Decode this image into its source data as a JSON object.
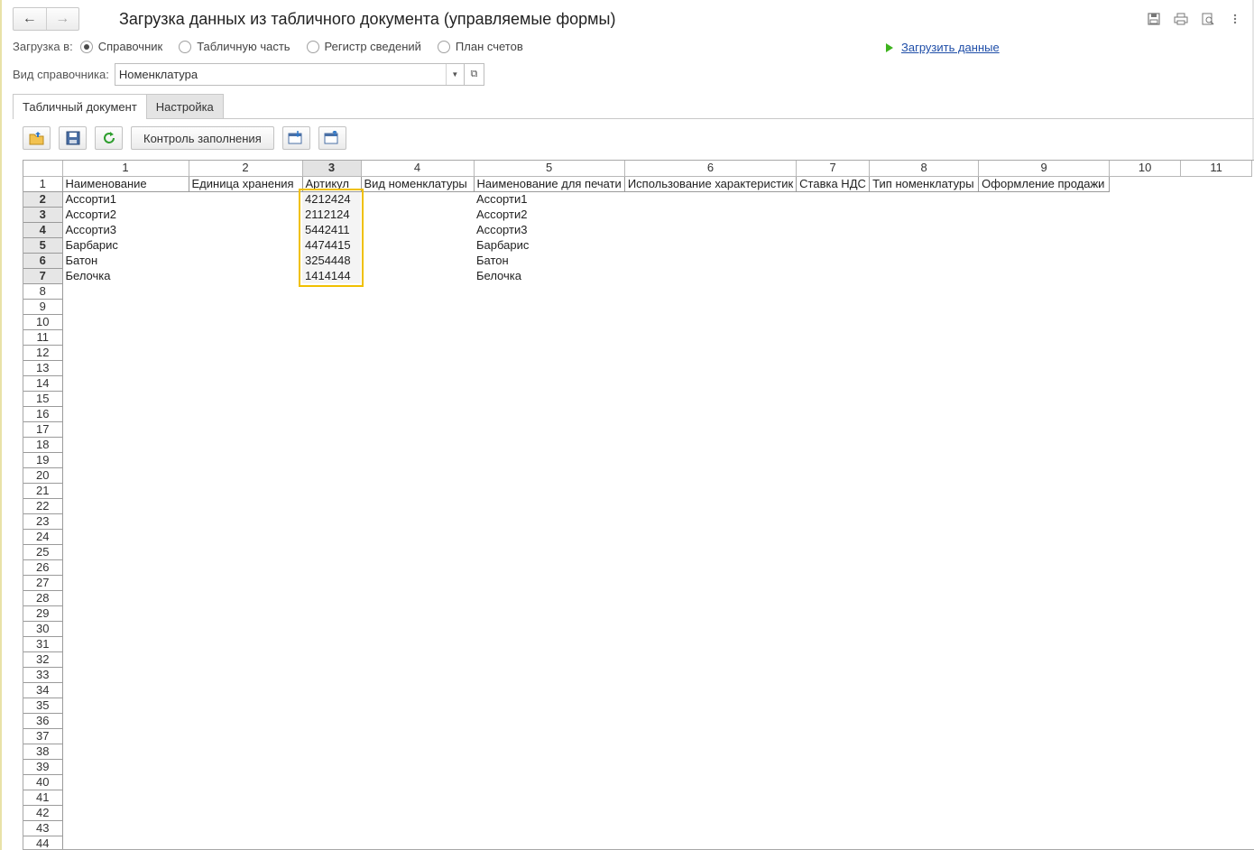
{
  "window": {
    "title": "Загрузка данных из табличного документа (управляемые формы)",
    "icons": [
      "save-icon",
      "print-icon",
      "preview-icon",
      "more-icon"
    ]
  },
  "load_to": {
    "label": "Загрузка в:",
    "options": [
      {
        "label": "Справочник",
        "selected": true
      },
      {
        "label": "Табличную часть",
        "selected": false
      },
      {
        "label": "Регистр сведений",
        "selected": false
      },
      {
        "label": "План счетов",
        "selected": false
      }
    ],
    "load_link": "Загрузить данные"
  },
  "catalog_kind": {
    "label": "Вид справочника:",
    "value": "Номенклатура"
  },
  "tabs": [
    {
      "label": "Табличный документ",
      "active": true
    },
    {
      "label": "Настройка",
      "active": false
    }
  ],
  "toolbar": {
    "check_fill_label": "Контроль заполнения"
  },
  "sheet": {
    "column_numbers": [
      "1",
      "2",
      "3",
      "4",
      "5",
      "6",
      "7",
      "8",
      "9",
      "10",
      "11"
    ],
    "selected_column": "3",
    "header_row": [
      "Наименование",
      "Единица хранения",
      "Артикул",
      "Вид номенклатуры",
      "Наименование для печати",
      "Использование характеристик",
      "Ставка НДС",
      "Тип номенклатуры",
      "Оформление продажи"
    ],
    "data_rows": [
      [
        "Ассорти1",
        "",
        "4212424",
        "",
        "Ассорти1"
      ],
      [
        "Ассорти2",
        "",
        "2112124",
        "",
        "Ассорти2"
      ],
      [
        "Ассорти3",
        "",
        "5442411",
        "",
        "Ассорти3"
      ],
      [
        "Барбарис",
        "",
        "4474415",
        "",
        "Барбарис"
      ],
      [
        "Батон",
        "",
        "3254448",
        "",
        "Батон"
      ],
      [
        "Белочка",
        "",
        "1414144",
        "",
        "Белочка"
      ]
    ],
    "selected_rows": [
      "2",
      "3",
      "4",
      "5",
      "6",
      "7"
    ],
    "total_rows_visible": 44
  },
  "colors": {
    "link": "#1f4ea8",
    "play": "#3db31d",
    "selection": "#f0c000"
  }
}
